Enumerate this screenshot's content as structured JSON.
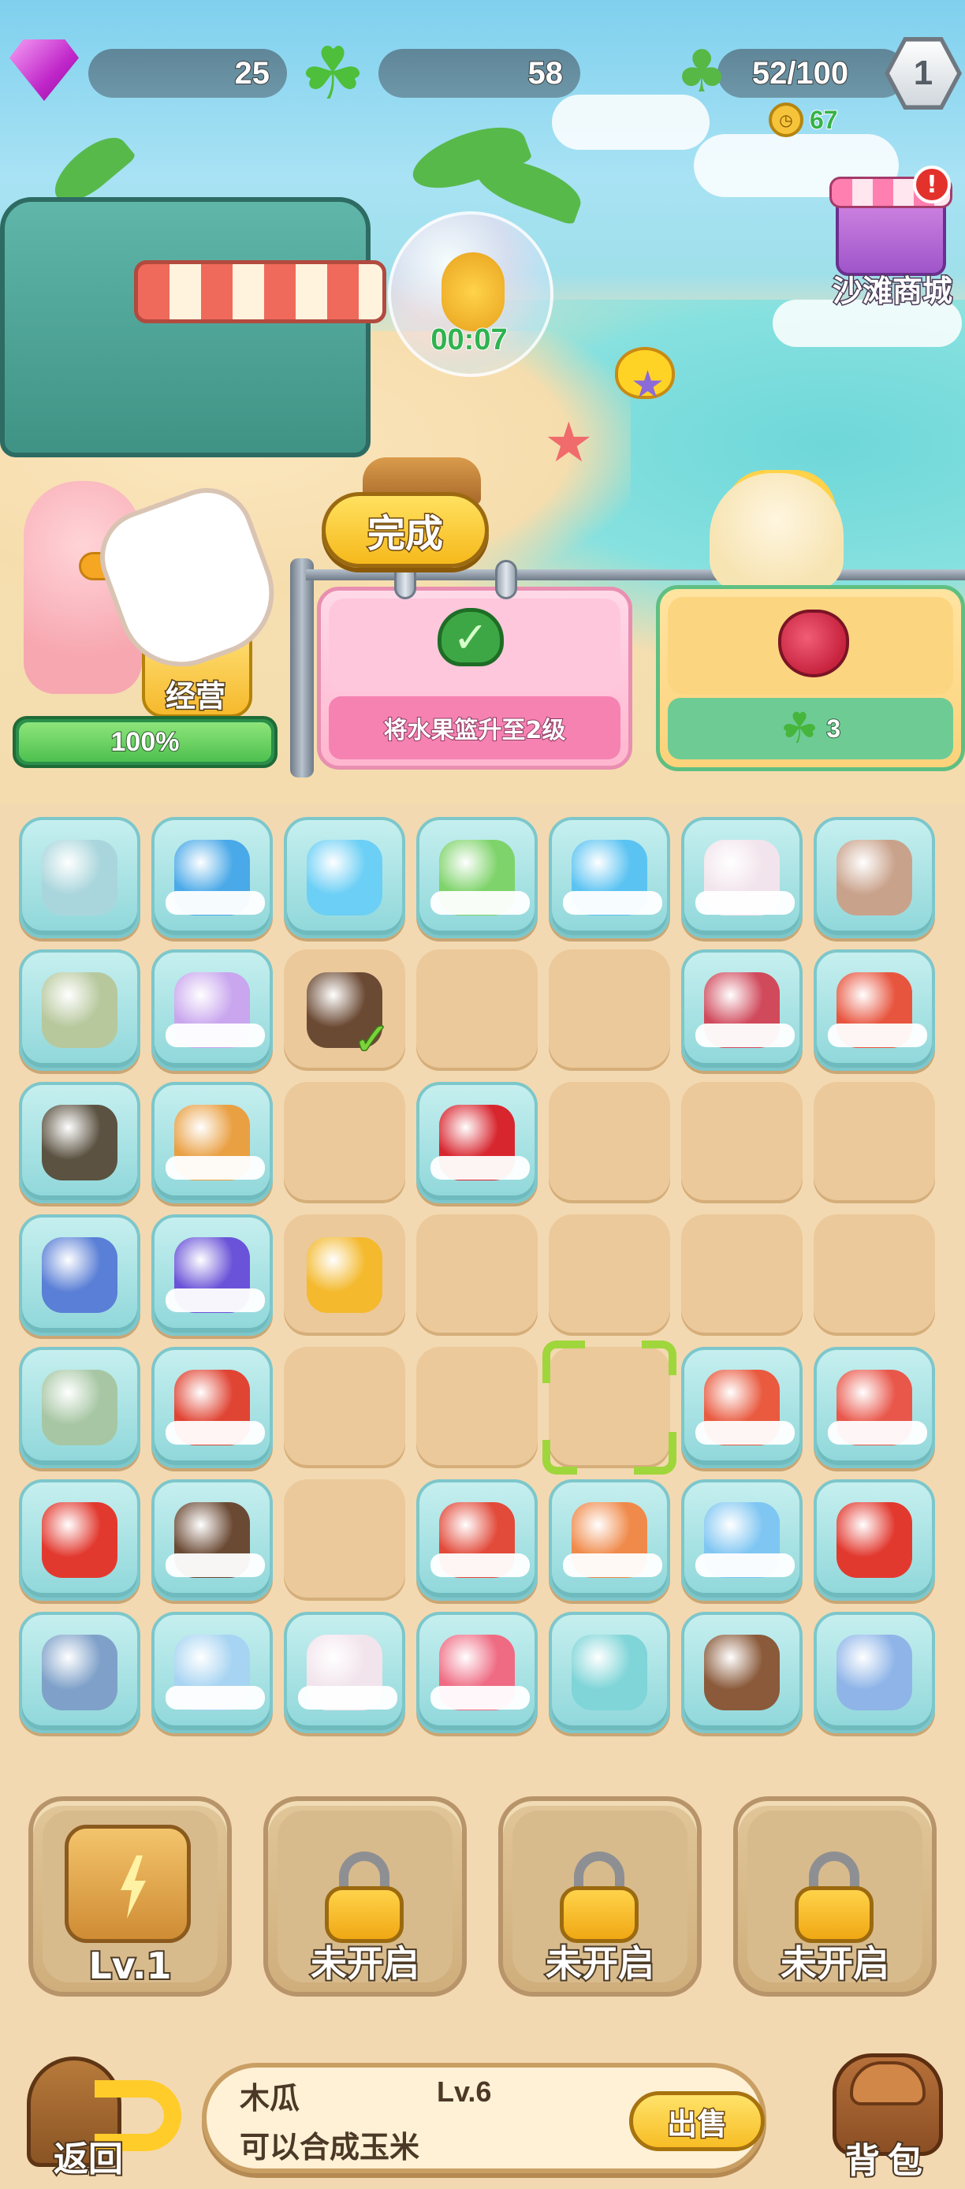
{
  "resources": {
    "gems": "25",
    "clovers": "58",
    "energy": "52/100",
    "player_level": "1",
    "energy_timer": "67"
  },
  "scene": {
    "bubble_timer": "00:07",
    "shop_label": "沙滩商城",
    "shop_alert": "!"
  },
  "manage": {
    "label": "经营",
    "progress_text": "100%",
    "progress_value": 1.0
  },
  "order": {
    "complete_label": "完成",
    "task_text": "将水果篮升至2级",
    "reward_count": "3"
  },
  "board": {
    "rows": [
      [
        {
          "item": "hook-icon",
          "bubbled": true,
          "color": "#a9d6dc"
        },
        {
          "item": "towel-roll-icon",
          "bubbled": true,
          "wrapped": true,
          "color": "#4aa9e8"
        },
        {
          "item": "ice-cube-icon",
          "bubbled": true,
          "color": "#6ccff5"
        },
        {
          "item": "green-box-icon",
          "bubbled": true,
          "wrapped": true,
          "color": "#7ed36a"
        },
        {
          "item": "ice-cubes-icon",
          "bubbled": true,
          "wrapped": true,
          "color": "#5bc3f2"
        },
        {
          "item": "lunchbox-icon",
          "bubbled": true,
          "wrapped": true,
          "color": "#f2e4ec"
        },
        {
          "item": "cup-icon",
          "bubbled": true,
          "color": "#c9a28b"
        }
      ],
      [
        {
          "item": "backpack-icon",
          "bubbled": true,
          "color": "#b7c89d"
        },
        {
          "item": "starfish-purple-icon",
          "bubbled": true,
          "wrapped": true,
          "color": "#c9a6ee"
        },
        {
          "item": "coconut-sprout-icon",
          "bubbled": false,
          "checked": true,
          "color": "#6b4a34"
        },
        {
          "item": "empty",
          "bubbled": false
        },
        {
          "item": "empty",
          "bubbled": false
        },
        {
          "item": "raspberry-icon",
          "bubbled": true,
          "wrapped": true,
          "color": "#d04a5c"
        },
        {
          "item": "red-fish-icon",
          "bubbled": true,
          "wrapped": true,
          "color": "#e8553f"
        }
      ],
      [
        {
          "item": "seed-icon",
          "bubbled": true,
          "color": "#5b5241"
        },
        {
          "item": "eel-icon",
          "bubbled": true,
          "wrapped": true,
          "color": "#e9a043"
        },
        {
          "item": "empty",
          "bubbled": false
        },
        {
          "item": "cherry-icon",
          "bubbled": true,
          "wrapped": true,
          "color": "#d8262f"
        },
        {
          "item": "empty",
          "bubbled": false
        },
        {
          "item": "empty",
          "bubbled": false
        },
        {
          "item": "empty",
          "bubbled": false
        }
      ],
      [
        {
          "item": "coral-icon",
          "bubbled": true,
          "color": "#5a7fd6"
        },
        {
          "item": "seahorse-icon",
          "bubbled": true,
          "wrapped": true,
          "color": "#6a53d8"
        },
        {
          "item": "pineapple-icon",
          "bubbled": false,
          "color": "#f4b92d"
        },
        {
          "item": "empty",
          "bubbled": false
        },
        {
          "item": "empty",
          "bubbled": false
        },
        {
          "item": "empty",
          "bubbled": false
        },
        {
          "item": "empty",
          "bubbled": false
        }
      ],
      [
        {
          "item": "cooler-bag-icon",
          "bubbled": true,
          "color": "#a7c7a4"
        },
        {
          "item": "lobster-icon",
          "bubbled": true,
          "wrapped": true,
          "color": "#e04433"
        },
        {
          "item": "empty",
          "bubbled": false
        },
        {
          "item": "empty",
          "bubbled": false
        },
        {
          "item": "empty",
          "bubbled": false,
          "selected": true
        },
        {
          "item": "crab-meat-icon",
          "bubbled": true,
          "wrapped": true,
          "color": "#e95a3f"
        },
        {
          "item": "koi-fish-icon",
          "bubbled": true,
          "wrapped": true,
          "color": "#e9574b"
        }
      ],
      [
        {
          "item": "strawberry-icon",
          "bubbled": true,
          "color": "#e2392f"
        },
        {
          "item": "coconut-icon",
          "bubbled": true,
          "wrapped": true,
          "color": "#6b4a34"
        },
        {
          "item": "empty",
          "bubbled": false
        },
        {
          "item": "tomato-icon",
          "bubbled": true,
          "wrapped": true,
          "color": "#e24a3a"
        },
        {
          "item": "shrimp-icon",
          "bubbled": true,
          "wrapped": true,
          "color": "#f08a4a"
        },
        {
          "item": "starfish-blue-icon",
          "bubbled": true,
          "wrapped": true,
          "color": "#7fc6f2"
        },
        {
          "item": "strawberry-icon",
          "bubbled": true,
          "color": "#e2392f"
        }
      ],
      [
        {
          "item": "sunscreen-jar-icon",
          "bubbled": true,
          "color": "#7fa1c9"
        },
        {
          "item": "water-bottle-icon",
          "bubbled": true,
          "wrapped": true,
          "color": "#a7d4f2"
        },
        {
          "item": "lunchbox-icon",
          "bubbled": true,
          "wrapped": true,
          "color": "#f2e4ec"
        },
        {
          "item": "sunglasses-icon",
          "bubbled": true,
          "wrapped": true,
          "color": "#ef6b83"
        },
        {
          "item": "cooler-box-icon",
          "bubbled": true,
          "color": "#7fd5d8"
        },
        {
          "item": "popsicle-icon",
          "bubbled": true,
          "color": "#8a5a3a"
        },
        {
          "item": "sunscreen-tube-icon",
          "bubbled": true,
          "color": "#8fb5e8"
        }
      ]
    ]
  },
  "producers": [
    {
      "label": "Lv.1",
      "locked": false,
      "icon": "lemon-maker-icon"
    },
    {
      "label": "未开启",
      "locked": true,
      "icon": "lock-icon"
    },
    {
      "label": "未开启",
      "locked": true,
      "icon": "lock-icon"
    },
    {
      "label": "未开启",
      "locked": true,
      "icon": "lock-icon"
    }
  ],
  "bottom": {
    "back_label": "返回",
    "item_name": "木瓜",
    "item_level": "Lv.6",
    "item_desc": "可以合成玉米",
    "sell_label": "出售",
    "backpack_label": "背包"
  },
  "colors": {
    "sand": "#f3d9b1",
    "bubble_cell": "#8fd7da",
    "empty_cell": "#ebc99b",
    "select_frame": "#9fd63b",
    "accent_yellow": "#f6b91c"
  }
}
